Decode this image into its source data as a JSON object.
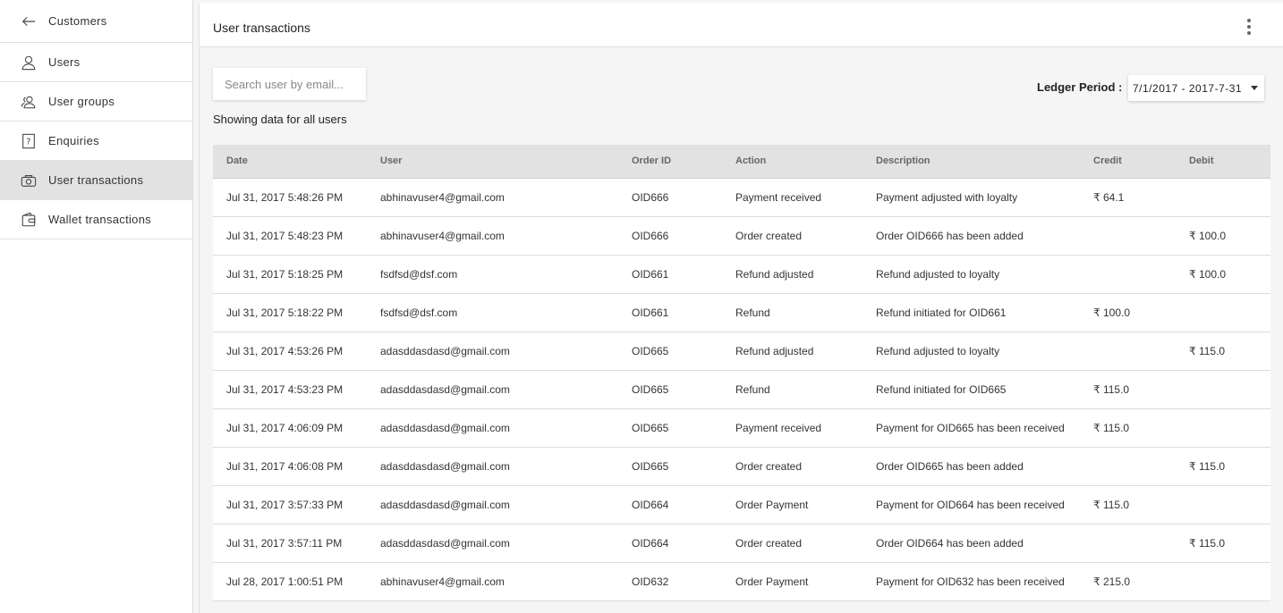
{
  "sidebar": {
    "back": {
      "label": "Customers",
      "icon": "arrow-left-icon"
    },
    "items": [
      {
        "label": "Users",
        "icon": "user-icon"
      },
      {
        "label": "User groups",
        "icon": "user-group-icon"
      },
      {
        "label": "Enquiries",
        "icon": "question-box-icon"
      },
      {
        "label": "User transactions",
        "icon": "transaction-icon",
        "active": true
      },
      {
        "label": "Wallet transactions",
        "icon": "wallet-icon"
      }
    ]
  },
  "header": {
    "title": "User transactions",
    "menu_icon": "more-vert-icon"
  },
  "filters": {
    "search_placeholder": "Search user by email...",
    "search_value": "",
    "showing_text": "Showing data for all users",
    "ledger_label": "Ledger Period :",
    "ledger_value": "7/1/2017 - 2017-7-31"
  },
  "table": {
    "columns": [
      "Date",
      "User",
      "Order ID",
      "Action",
      "Description",
      "Credit",
      "Debit"
    ],
    "rows": [
      [
        "Jul 31, 2017 5:48:26 PM",
        "abhinavuser4@gmail.com",
        "OID666",
        "Payment received",
        "Payment adjusted with loyalty",
        "₹ 64.1",
        ""
      ],
      [
        "Jul 31, 2017 5:48:23 PM",
        "abhinavuser4@gmail.com",
        "OID666",
        "Order created",
        "Order OID666 has been added",
        "",
        "₹ 100.0"
      ],
      [
        "Jul 31, 2017 5:18:25 PM",
        "fsdfsd@dsf.com",
        "OID661",
        "Refund adjusted",
        "Refund adjusted to loyalty",
        "",
        "₹ 100.0"
      ],
      [
        "Jul 31, 2017 5:18:22 PM",
        "fsdfsd@dsf.com",
        "OID661",
        "Refund",
        "Refund initiated for OID661",
        "₹ 100.0",
        ""
      ],
      [
        "Jul 31, 2017 4:53:26 PM",
        "adasddasdasd@gmail.com",
        "OID665",
        "Refund adjusted",
        "Refund adjusted to loyalty",
        "",
        "₹ 115.0"
      ],
      [
        "Jul 31, 2017 4:53:23 PM",
        "adasddasdasd@gmail.com",
        "OID665",
        "Refund",
        "Refund initiated for OID665",
        "₹ 115.0",
        ""
      ],
      [
        "Jul 31, 2017 4:06:09 PM",
        "adasddasdasd@gmail.com",
        "OID665",
        "Payment received",
        "Payment for OID665 has been received",
        "₹ 115.0",
        ""
      ],
      [
        "Jul 31, 2017 4:06:08 PM",
        "adasddasdasd@gmail.com",
        "OID665",
        "Order created",
        "Order OID665 has been added",
        "",
        "₹ 115.0"
      ],
      [
        "Jul 31, 2017 3:57:33 PM",
        "adasddasdasd@gmail.com",
        "OID664",
        "Order Payment",
        "Payment for OID664 has been received",
        "₹ 115.0",
        ""
      ],
      [
        "Jul 31, 2017 3:57:11 PM",
        "adasddasdasd@gmail.com",
        "OID664",
        "Order created",
        "Order OID664 has been added",
        "",
        "₹ 115.0"
      ],
      [
        "Jul 28, 2017 1:00:51 PM",
        "abhinavuser4@gmail.com",
        "OID632",
        "Order Payment",
        "Payment for OID632 has been received",
        "₹ 215.0",
        ""
      ]
    ]
  }
}
